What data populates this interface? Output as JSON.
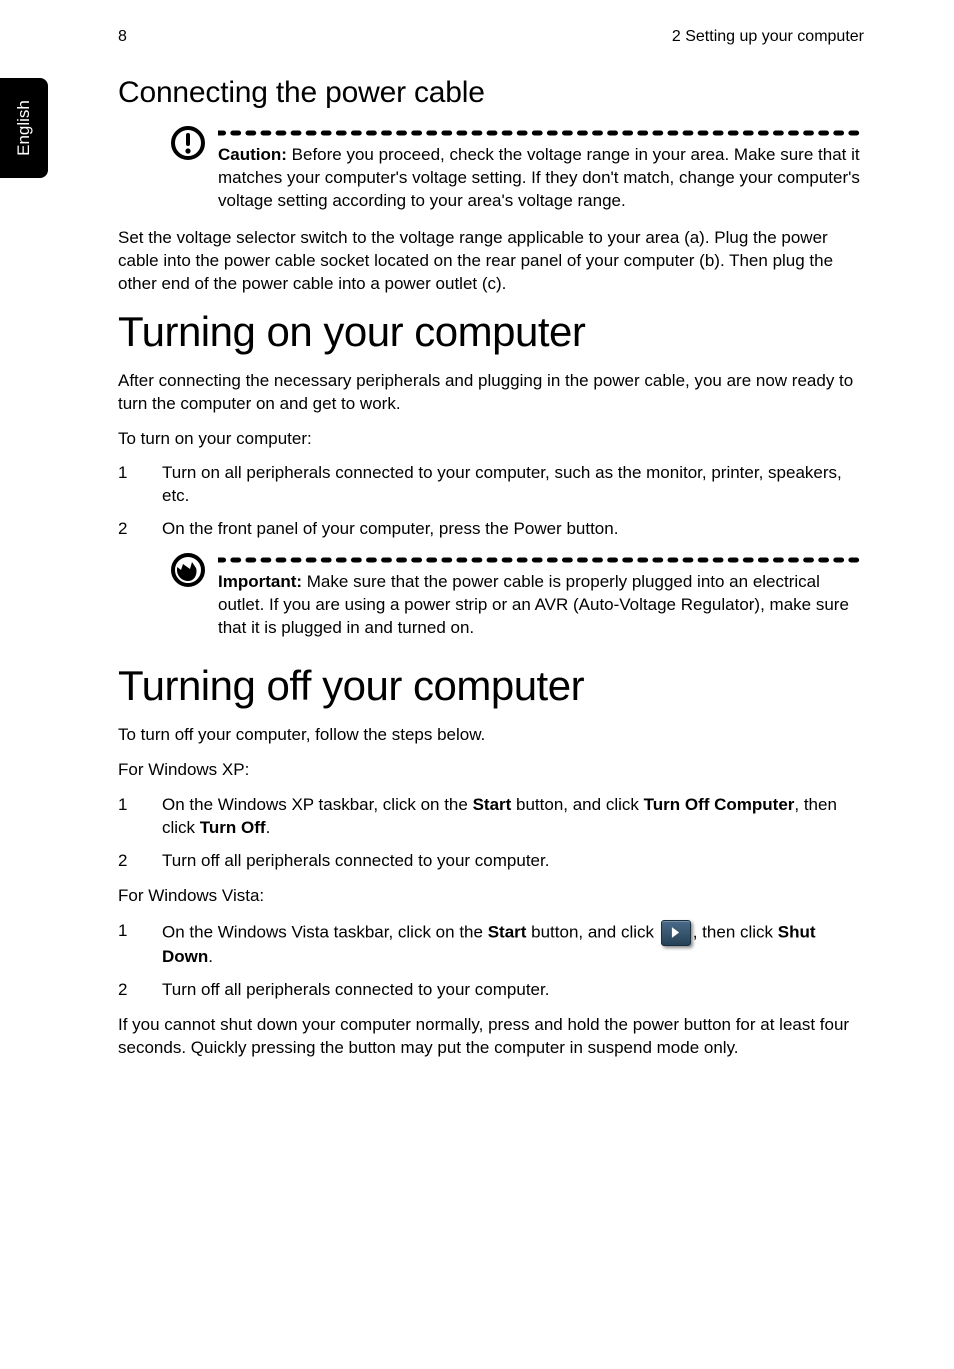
{
  "header": {
    "page_number": "8",
    "chapter_title": "2 Setting up your computer"
  },
  "lang_tab": "English",
  "section_connect": {
    "heading": "Connecting the power cable",
    "caution_label": "Caution:",
    "caution_text": " Before you proceed, check the voltage range in your area. Make sure that it matches your computer's voltage setting. If they don't match, change your computer's voltage setting according to your area's voltage range.",
    "body": "Set the voltage selector switch to the voltage range applicable to your area (a). Plug the power cable into the power cable socket located on the rear panel of your computer (b). Then plug the other end of the power cable into a power outlet (c)."
  },
  "section_on": {
    "heading": "Turning on your computer",
    "intro": "After connecting the necessary peripherals and plugging in the power cable, you are now ready to turn the computer on and get to work.",
    "sub": "To turn on your computer:",
    "steps": [
      "Turn on all peripherals connected to your computer, such as the monitor, printer, speakers, etc.",
      "On the front panel of your computer, press the Power button."
    ],
    "important_label": "Important:",
    "important_text": " Make sure that the power cable is properly plugged into an electrical outlet. If you are using a power strip or an AVR (Auto-Voltage Regulator), make sure that it is plugged in and turned on."
  },
  "section_off": {
    "heading": "Turning off your computer",
    "intro": "To turn off your computer, follow the steps below.",
    "xp_label": "For Windows XP:",
    "xp_step1_a": "On the Windows XP taskbar, click on the ",
    "xp_step1_b": "Start",
    "xp_step1_c": " button, and click ",
    "xp_step1_d": "Turn Off Computer",
    "xp_step1_e": ", then click ",
    "xp_step1_f": "Turn Off",
    "xp_step1_g": ".",
    "xp_step2": "Turn off all peripherals connected to your computer.",
    "vista_label": "For Windows Vista:",
    "vista_step1_a": "On the Windows Vista taskbar, click on the ",
    "vista_step1_b": "Start",
    "vista_step1_c": " button, and click ",
    "vista_step1_d": ", then click ",
    "vista_step1_e": "Shut Down",
    "vista_step1_f": ".",
    "vista_step2": "Turn off all peripherals connected to your computer.",
    "outro": "If you cannot shut down your computer normally, press and hold the power button for at least four seconds. Quickly pressing the button may put the computer in suspend mode only."
  }
}
